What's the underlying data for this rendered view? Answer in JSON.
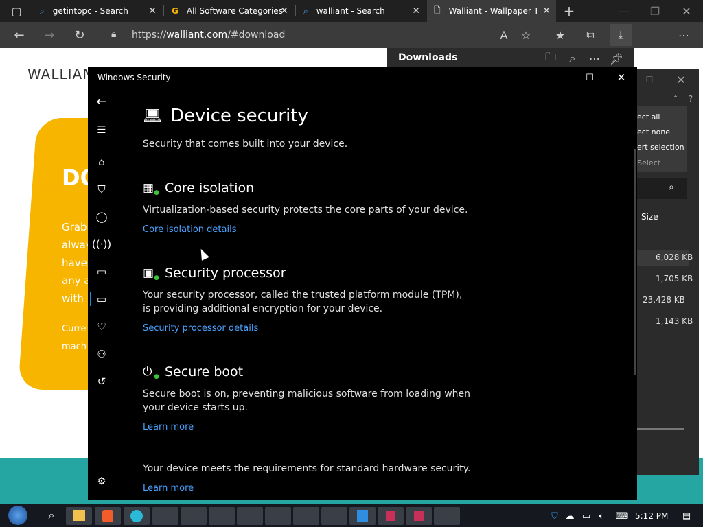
{
  "browser": {
    "tabs": [
      {
        "label": "getintopc - Search",
        "icon": "search-icon"
      },
      {
        "label": "All Software Categories",
        "icon": "g-logo-icon"
      },
      {
        "label": "walliant - Search",
        "icon": "search-icon"
      },
      {
        "label": "Walliant - Wallpaper Th",
        "icon": "page-icon"
      }
    ],
    "url_prefix": "https://",
    "url_domain": "walliant.com",
    "url_path": "/#download"
  },
  "webpage": {
    "brand": "WALLIAN",
    "card_heading": "DO",
    "card_lines": [
      "Grab",
      "alway",
      "have",
      "any a",
      "with"
    ],
    "card_footer": [
      "Curre",
      "mach"
    ]
  },
  "downloads_panel": {
    "title": "Downloads"
  },
  "explorer": {
    "menu": [
      "ect all",
      "ect none",
      "ert selection"
    ],
    "select_label": "Select",
    "size_header": "Size",
    "sizes": [
      "6,028 KB",
      "1,705 KB",
      "23,428 KB",
      "1,143 KB"
    ]
  },
  "windows_security": {
    "window_title": "Windows Security",
    "page_title": "Device security",
    "page_subtitle": "Security that comes built into your device.",
    "sections": [
      {
        "title": "Core isolation",
        "description": "Virtualization-based security protects the core parts of your device.",
        "link": "Core isolation details"
      },
      {
        "title": "Security processor",
        "description": "Your security processor, called the trusted platform module (TPM), is providing additional encryption for your device.",
        "link": "Security processor details"
      },
      {
        "title": "Secure boot",
        "description": "Secure boot is on, preventing malicious software from loading when your device starts up.",
        "link": "Learn more"
      }
    ],
    "footer_text": "Your device meets the requirements for standard hardware security.",
    "footer_link": "Learn more"
  },
  "taskbar": {
    "clock": "5:12 PM"
  },
  "colors": {
    "accent_link": "#4aa3ff",
    "yellow_card": "#f7b500",
    "teal_band": "#25a6a2"
  }
}
